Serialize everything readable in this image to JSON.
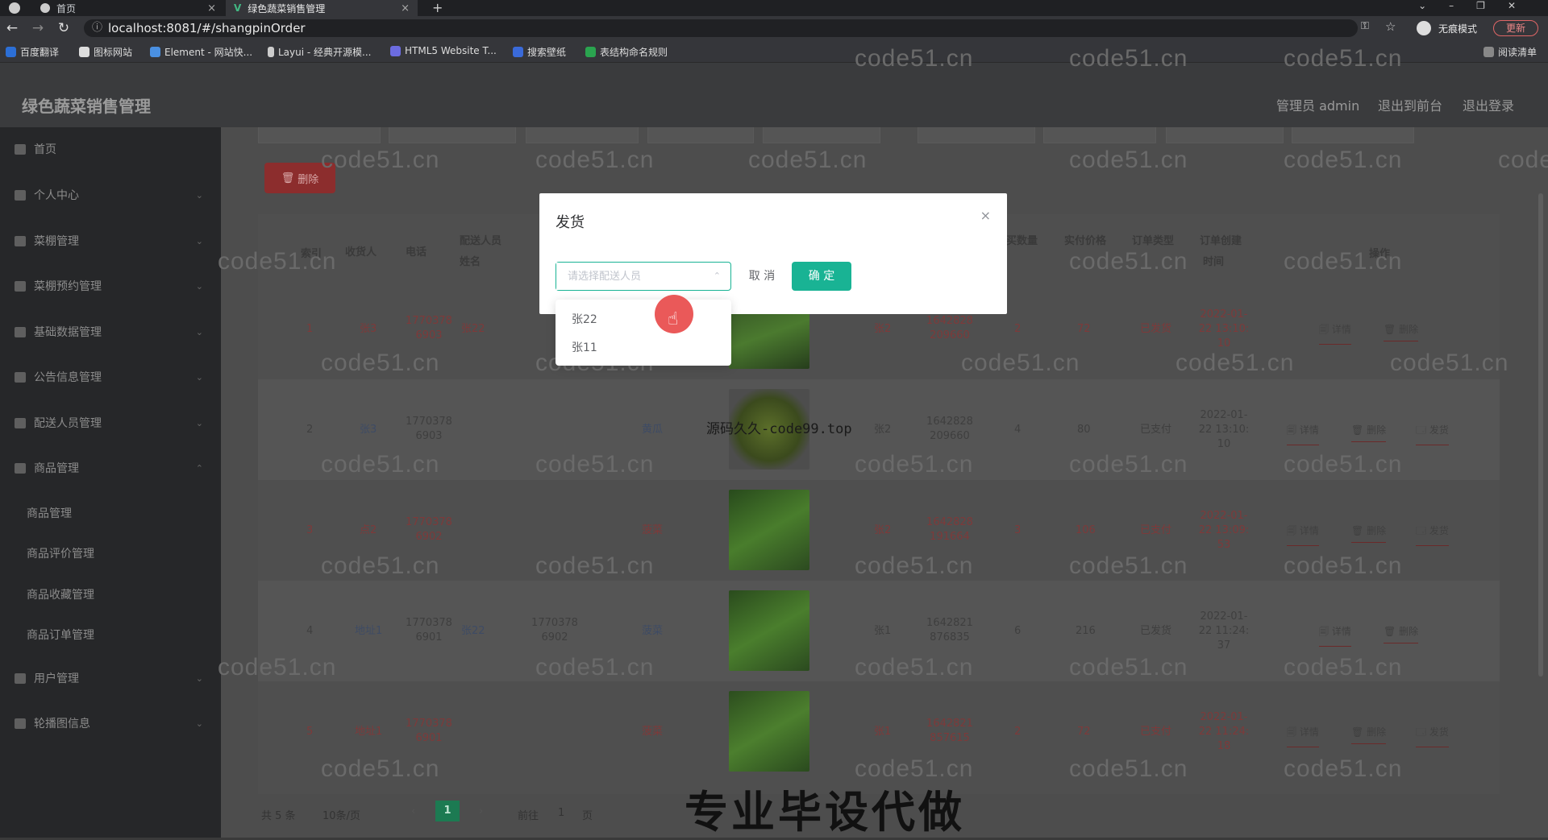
{
  "browser": {
    "tabs": [
      {
        "label": "首页"
      },
      {
        "label": "绿色蔬菜销售管理"
      }
    ],
    "url": "localhost:8081/#/shangpinOrder",
    "incognito_label": "无痕模式",
    "update_label": "更新",
    "reading_list": "阅读清单",
    "bookmarks": [
      "百度翻译",
      "图标网站",
      "Element - 网站快...",
      "Layui - 经典开源模...",
      "HTML5 Website T...",
      "搜索壁纸",
      "表结构命名规则"
    ]
  },
  "app": {
    "title": "绿色蔬菜销售管理",
    "admin_label": "管理员 admin",
    "to_front": "退出到前台",
    "logout": "退出登录"
  },
  "sidebar": {
    "items": [
      {
        "label": "首页"
      },
      {
        "label": "个人中心"
      },
      {
        "label": "菜棚管理"
      },
      {
        "label": "菜棚预约管理"
      },
      {
        "label": "基础数据管理"
      },
      {
        "label": "公告信息管理"
      },
      {
        "label": "配送人员管理"
      },
      {
        "label": "商品管理"
      }
    ],
    "sub_items": [
      {
        "label": "商品管理"
      },
      {
        "label": "商品评价管理"
      },
      {
        "label": "商品收藏管理"
      },
      {
        "label": "商品订单管理"
      }
    ],
    "tail_items": [
      {
        "label": "用户管理"
      },
      {
        "label": "轮播图信息"
      }
    ]
  },
  "toolbar": {
    "delete_label": "删除"
  },
  "table": {
    "headers": {
      "index": "索引",
      "receiver": "收货人",
      "phone": "电话",
      "courier_name_1": "配送人员",
      "courier_name_2": "姓名",
      "qty": "买数量",
      "price": "实付价格",
      "type": "订单类型",
      "created_1": "订单创建",
      "created_2": "时间",
      "ops": "操作"
    },
    "rows": [
      {
        "index": "1",
        "receiver": "张3",
        "phone": "1770378 6903",
        "courier": "张22",
        "courier_phone": "",
        "product": "",
        "user": "张2",
        "order_no": "1642828 209660",
        "qty": "2",
        "price": "72",
        "type": "已发货",
        "created": "2022-01- 22 13:10: 10",
        "ops": [
          "详情",
          "删除"
        ]
      },
      {
        "index": "2",
        "receiver": "张3",
        "phone": "1770378 6903",
        "courier": "",
        "courier_phone": "",
        "product": "黄瓜",
        "user": "张2",
        "order_no": "1642828 209660",
        "qty": "4",
        "price": "80",
        "type": "已支付",
        "created": "2022-01- 22 13:10: 10",
        "ops": [
          "详情",
          "删除",
          "发货"
        ]
      },
      {
        "index": "3",
        "receiver": "点2",
        "phone": "1770378 6902",
        "courier": "",
        "courier_phone": "",
        "product": "菠菜",
        "user": "张2",
        "order_no": "1642828 191664",
        "qty": "3",
        "price": "106",
        "type": "已支付",
        "created": "2022-01- 22 13:09: 53",
        "ops": [
          "详情",
          "删除",
          "发货"
        ]
      },
      {
        "index": "4",
        "receiver": "地址1",
        "phone": "1770378 6901",
        "courier": "张22",
        "courier_phone": "1770378 6902",
        "product": "菠菜",
        "user": "张1",
        "order_no": "1642821 876835",
        "qty": "6",
        "price": "216",
        "type": "已发货",
        "created": "2022-01- 22 11:24: 37",
        "ops": [
          "详情",
          "删除"
        ]
      },
      {
        "index": "5",
        "receiver": "地址1",
        "phone": "1770378 6901",
        "courier": "",
        "courier_phone": "",
        "product": "菠菜",
        "user": "张1",
        "order_no": "1642821 857615",
        "qty": "2",
        "price": "72",
        "type": "已支付",
        "created": "2022-01- 22 11:24: 18",
        "ops": [
          "详情",
          "删除",
          "发货"
        ]
      }
    ]
  },
  "pager": {
    "total": "共 5 条",
    "page_size": "10条/页",
    "current": "1",
    "goto_label": "前往",
    "goto_value": "1",
    "page_unit": "页"
  },
  "modal": {
    "title": "发货",
    "placeholder": "请选择配送人员",
    "cancel": "取 消",
    "confirm": "确 定",
    "options": [
      "张22",
      "张11"
    ]
  },
  "overlays": {
    "watermark": "code51.cn",
    "source_text": "源码久久-code99.top",
    "caption": "专业毕设代做"
  },
  "colors": {
    "accent": "#19b394",
    "danger": "#8c2d2d"
  }
}
